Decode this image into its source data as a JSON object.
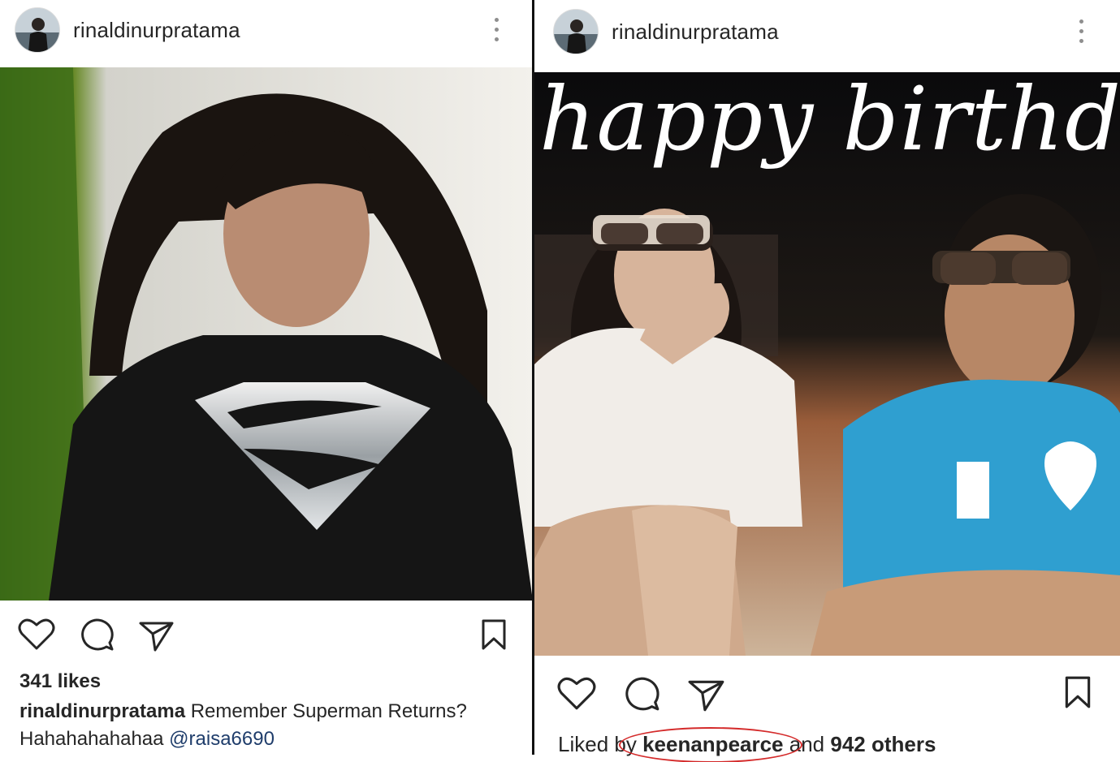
{
  "left_post": {
    "username": "rinaldinurpratama",
    "likes": "341 likes",
    "caption_user": "rinaldinurpratama",
    "caption_text": " Remember Superman Returns?",
    "caption_text2": "Hahahahahahaa ",
    "caption_mention": "@raisa6690"
  },
  "right_post": {
    "username": "rinaldinurpratama",
    "overlay_text": "happy birthday",
    "liked_prefix": "Liked by ",
    "liked_user": "keenanpearce",
    "liked_mid": " and ",
    "liked_count": "942 others"
  },
  "icons": {
    "avatar": "avatar-photo",
    "more": "more-vertical-icon",
    "like": "heart-icon",
    "comment": "comment-bubble-icon",
    "share": "paper-plane-icon",
    "save": "bookmark-icon"
  },
  "colors": {
    "annotation_circle": "#d42a2a",
    "mention": "#1f3d6b"
  }
}
